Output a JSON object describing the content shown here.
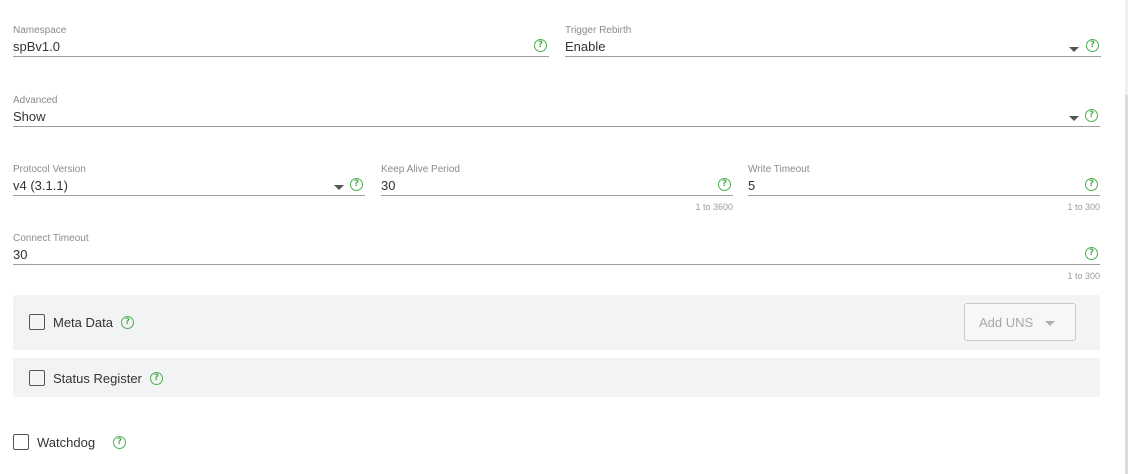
{
  "fields": {
    "namespace": {
      "label": "Namespace",
      "value": "spBv1.0"
    },
    "trigger_rebirth": {
      "label": "Trigger Rebirth",
      "value": "Enable"
    },
    "advanced": {
      "label": "Advanced",
      "value": "Show"
    },
    "protocol_version": {
      "label": "Protocol Version",
      "value": "v4 (3.1.1)"
    },
    "keep_alive": {
      "label": "Keep Alive Period",
      "value": "30",
      "hint": "1 to 3600"
    },
    "write_timeout": {
      "label": "Write Timeout",
      "value": "5",
      "hint": "1 to 300"
    },
    "connect_timeout": {
      "label": "Connect Timeout",
      "value": "30",
      "hint": "1 to 300"
    }
  },
  "checkboxes": {
    "meta_data": {
      "label": "Meta Data",
      "checked": false
    },
    "status_register": {
      "label": "Status Register",
      "checked": false
    },
    "watchdog": {
      "label": "Watchdog",
      "checked": false
    }
  },
  "buttons": {
    "add_uns": "Add UNS"
  },
  "icons": {
    "help": "?",
    "help_icon": "help-circle-icon",
    "caret_icon": "caret-down-icon"
  },
  "colors": {
    "help": "#4caf50",
    "panel": "#f2f3f4",
    "underline": "#9e9e9e"
  }
}
